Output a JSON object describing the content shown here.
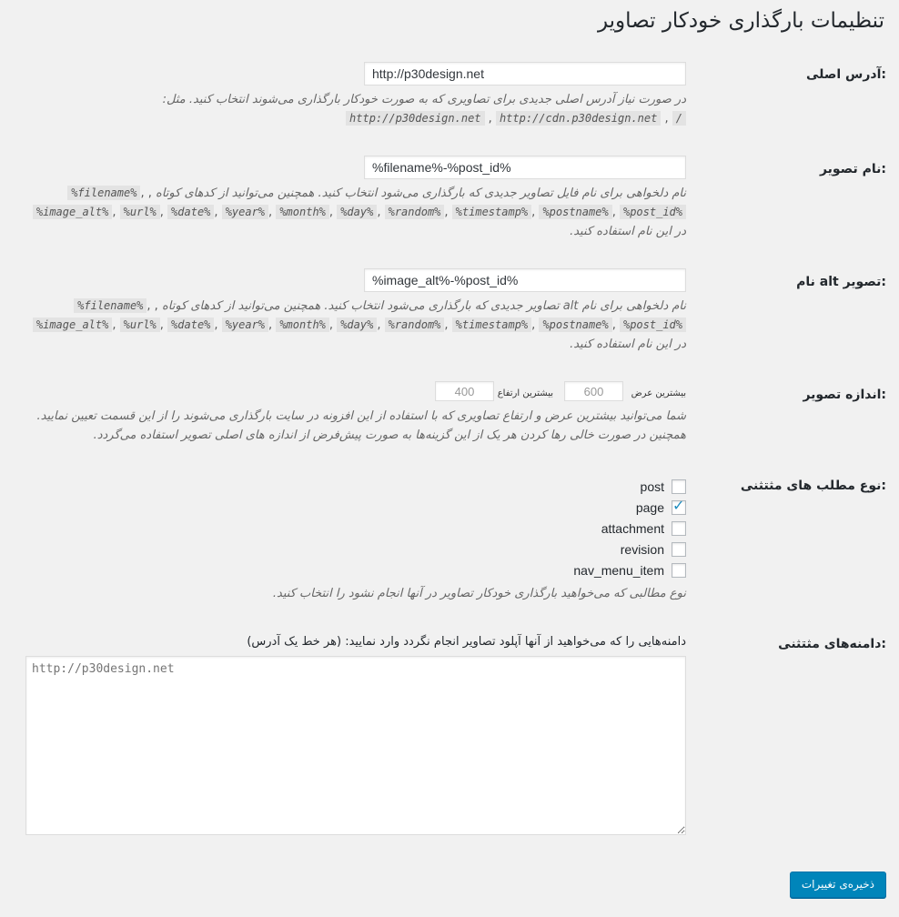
{
  "page_title": "تنظیمات بارگذاری خودکار تصاویر",
  "base_url": {
    "label": "آدرس اصلی:",
    "value": "http://p30design.net",
    "description": "در صورت نیاز آدرس اصلی جدیدی برای تصاویری که به صورت خودکار بارگذاری می‌شوند انتخاب کنید. مثل:",
    "examples": [
      "http://p30design.net",
      "http://cdn.p30design.net",
      "/"
    ]
  },
  "image_name": {
    "label": "نام تصویر:",
    "value": "%filename%-%post_id%",
    "description_start": "نام دلخواهی برای نام فایل تصاویر جدیدی که بارگذاری می‌شود انتخاب کنید. همچنین می‌توانید از کدهای کوتاه",
    "description_end": "در این نام استفاده کنید.",
    "codes": [
      "%filename%",
      "%image_alt%",
      "%url%",
      "%date%",
      "%year%",
      "%month%",
      "%day%",
      "%random%",
      "%timestamp%",
      "%postname%",
      "%post_id%"
    ]
  },
  "image_alt": {
    "label": "نام alt تصویر:",
    "value": "%image_alt%-%post_id%",
    "description_start": "نام دلخواهی برای نام alt تصاویر جدیدی که بارگذاری می‌شود انتخاب کنید. همچنین می‌توانید از کدهای کوتاه",
    "description_end": "در این نام استفاده کنید.",
    "codes": [
      "%filename%",
      "%image_alt%",
      "%url%",
      "%date%",
      "%year%",
      "%month%",
      "%day%",
      "%random%",
      "%timestamp%",
      "%postname%",
      "%post_id%"
    ]
  },
  "image_size": {
    "label": "اندازه تصویر:",
    "max_width_label": "بیشترین عرض",
    "max_width_value": "600",
    "max_height_label": "بیشترین ارتفاع",
    "max_height_value": "400",
    "description": "شما می‌توانید بیشترین عرض و ارتفاع تصاویری که با استفاده از این افزونه در سایت بارگذاری می‌شوند را از این قسمت تعیین نمایید. همچنین در صورت خالی رها کردن هر یک از این گزینه‌ها به صورت پیش‌فرض از اندازه های اصلی تصویر استفاده می‌گردد."
  },
  "excluded_post_types": {
    "label": "نوع مطلب های مثتثنی:",
    "options": [
      {
        "label": "post",
        "checked": false
      },
      {
        "label": "page",
        "checked": true
      },
      {
        "label": "attachment",
        "checked": false
      },
      {
        "label": "revision",
        "checked": false
      },
      {
        "label": "nav_menu_item",
        "checked": false
      }
    ],
    "description": "نوع مطالبی که می‌خواهید بارگذاری خودکار تصاویر در آنها انجام نشود را انتخاب کنید."
  },
  "excluded_domains": {
    "label": "دامنه‌های مثتثنی:",
    "description": "دامنه‌هایی را که می‌خواهید از آنها آپلود تصاویر انجام نگردد وارد نمایید: (هر خط یک آدرس)",
    "placeholder": "http://p30design.net"
  },
  "save_button": "ذخیره‌ی تغییرات"
}
